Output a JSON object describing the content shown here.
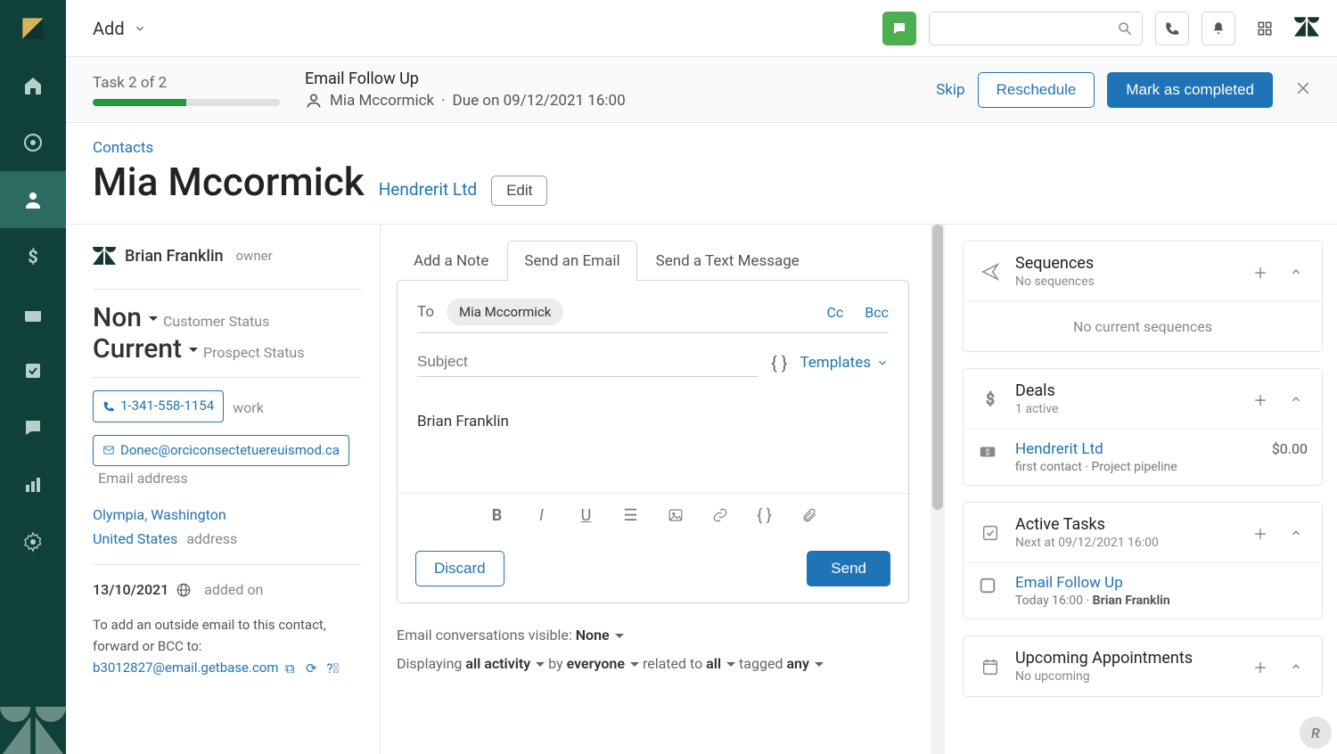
{
  "topbar": {
    "add_label": "Add"
  },
  "task": {
    "counter": "Task 2 of 2",
    "title": "Email Follow Up",
    "person": "Mia Mccormick",
    "due": "Due on 09/12/2021 16:00",
    "separator": "·",
    "skip": "Skip",
    "reschedule": "Reschedule",
    "complete": "Mark as completed"
  },
  "header": {
    "crumb": "Contacts",
    "name": "Mia Mccormick",
    "company": "Hendrerit Ltd",
    "edit": "Edit"
  },
  "left": {
    "owner_name": "Brian Franklin",
    "owner_role": "owner",
    "customer_status_value": "Non",
    "customer_status_label": "Customer Status",
    "prospect_status_value": "Current",
    "prospect_status_label": "Prospect Status",
    "phone": "1-341-558-1154",
    "phone_label": "work",
    "email": "Donec@orciconsectetuereuismod.ca",
    "email_label": "Email address",
    "loc_line1": "Olympia, Washington",
    "loc_line2": "United States",
    "loc_label": "address",
    "added_date": "13/10/2021",
    "added_label": "added on",
    "hint_prefix": "To add an outside email to this contact, forward or BCC to: ",
    "hint_email": "b3012827@email.getbase.com"
  },
  "compose": {
    "tab_note": "Add a Note",
    "tab_email": "Send an Email",
    "tab_text": "Send a Text Message",
    "to_label": "To",
    "to_value": "Mia Mccormick",
    "cc": "Cc",
    "bcc": "Bcc",
    "subject_placeholder": "Subject",
    "templates": "Templates",
    "signature": "Brian Franklin",
    "discard": "Discard",
    "send": "Send"
  },
  "filters": {
    "visible_label": "Email conversations visible: ",
    "visible_value": "None",
    "displaying": "Displaying ",
    "activity": "all activity",
    "by": " by ",
    "everyone": "everyone",
    "related": " related to ",
    "all": "all",
    "tagged": " tagged ",
    "any": "any"
  },
  "right": {
    "sequences": {
      "title": "Sequences",
      "sub": "No sequences",
      "empty": "No current sequences"
    },
    "deals": {
      "title": "Deals",
      "sub": "1 active",
      "row_title": "Hendrerit Ltd",
      "row_amount": "$0.00",
      "row_sub": "first contact · Project pipeline"
    },
    "tasks": {
      "title": "Active Tasks",
      "sub": "Next at 09/12/2021 16:00",
      "row_title": "Email Follow Up",
      "row_sub_time": "Today 16:00",
      "row_sub_sep": " · ",
      "row_sub_owner": "Brian Franklin"
    },
    "appts": {
      "title": "Upcoming Appointments",
      "sub": "No upcoming"
    }
  }
}
